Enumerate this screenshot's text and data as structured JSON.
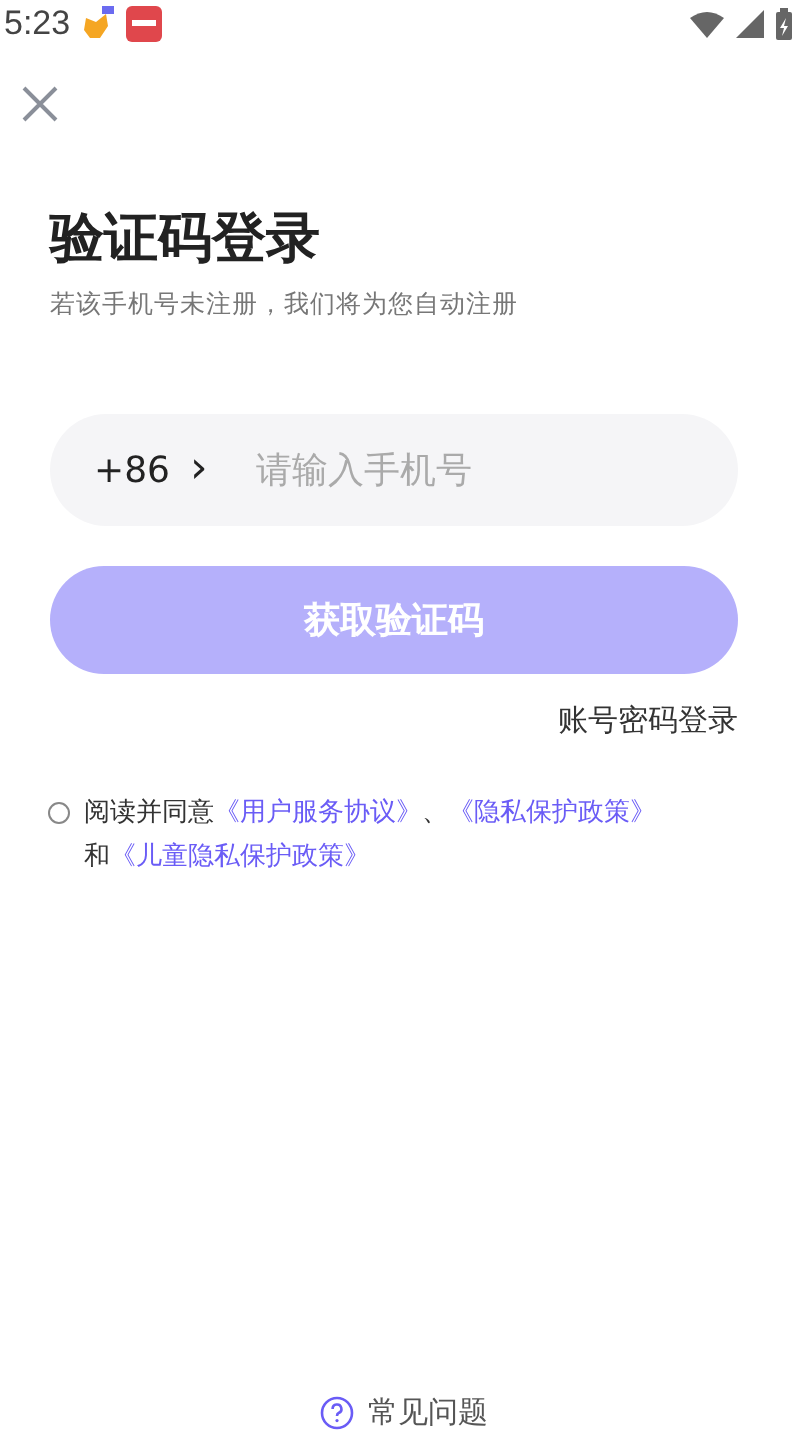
{
  "status_bar": {
    "time": "5:23"
  },
  "title": "验证码登录",
  "subtitle": "若该手机号未注册，我们将为您自动注册",
  "phone": {
    "country_code": "+86",
    "chevron": "›",
    "placeholder": "请输入手机号"
  },
  "get_code_button": {
    "label": "获取验证码",
    "disabled": true
  },
  "password_login_link": "账号密码登录",
  "agreement": {
    "checked": false,
    "lines": [
      [
        {
          "kind": "text",
          "text": "阅读并同意"
        },
        {
          "kind": "link",
          "text": "《用户服务协议》"
        },
        {
          "kind": "text",
          "text": "、"
        },
        {
          "kind": "link",
          "text": "《隐私保护政策》"
        }
      ],
      [
        {
          "kind": "text",
          "text": "和"
        },
        {
          "kind": "link",
          "text": "《儿童隐私保护政策》"
        }
      ]
    ]
  },
  "help": {
    "label": "常见问题"
  }
}
